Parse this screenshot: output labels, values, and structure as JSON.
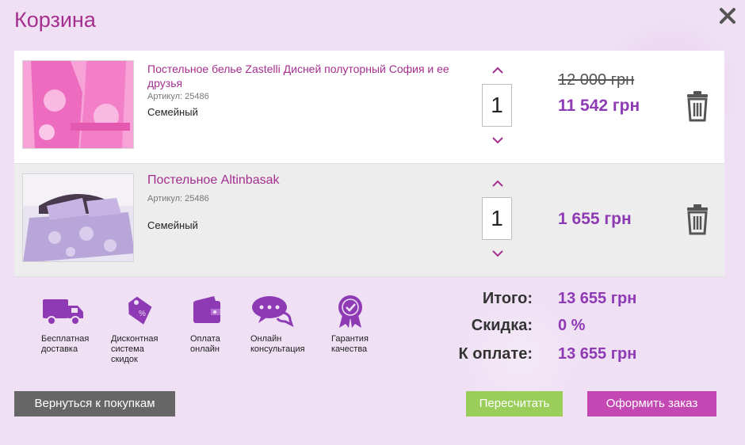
{
  "header": {
    "title": "Корзина"
  },
  "items": [
    {
      "name": "Постельное белье Zastelli Дисней полуторный София и ее друзья",
      "sku": "Артикул: 25486",
      "size": "Семейный",
      "qty": "1",
      "old_price": "12 000 грн",
      "price": "11 542 грн"
    },
    {
      "name": "Постельное Altinbasak",
      "sku": "Артикул: 25486",
      "size": "Семейный",
      "qty": "1",
      "price": "1 655 грн"
    }
  ],
  "features": [
    {
      "icon": "truck-icon",
      "label_l1": "Бесплатная",
      "label_l2": "доставка",
      "label_l3": ""
    },
    {
      "icon": "discount-tag-icon",
      "label_l1": "Дисконтная",
      "label_l2": "система",
      "label_l3": "скидок"
    },
    {
      "icon": "wallet-icon",
      "label_l1": "Оплата",
      "label_l2": "онлайн",
      "label_l3": ""
    },
    {
      "icon": "chat-icon",
      "label_l1": "Онлайн",
      "label_l2": "консультация",
      "label_l3": ""
    },
    {
      "icon": "quality-badge-icon",
      "label_l1": "Гарантия",
      "label_l2": "качества",
      "label_l3": ""
    }
  ],
  "totals": {
    "total_label": "Итого:",
    "total_value": "13 655 грн",
    "discount_label": "Скидка:",
    "discount_value": "0 %",
    "pay_label": "К оплате:",
    "pay_value": "13 655 грн"
  },
  "buttons": {
    "back": "Вернуться к покупкам",
    "recalc": "Пересчитать",
    "order": "Оформить заказ"
  },
  "colors": {
    "accent": "#a42f8e",
    "price": "#8e3ab4",
    "recalc": "#9acd5a",
    "order": "#c448b3",
    "back": "#666666"
  }
}
